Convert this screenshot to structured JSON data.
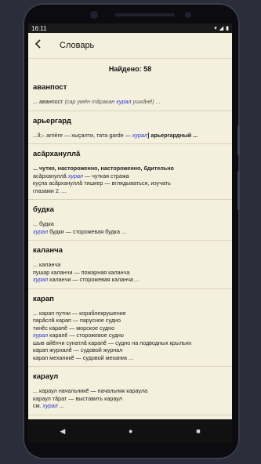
{
  "status": {
    "time": "16:11"
  },
  "appbar": {
    "title": "Словарь"
  },
  "found": "Найдено: 58",
  "entries": [
    {
      "head": "аванпост",
      "lines": [
        {
          "parts": [
            {
              "t": "... аванпост ",
              "c": ""
            },
            {
              "t": "(сар умĕн тăракан ",
              "c": "it"
            },
            {
              "t": "хурал",
              "c": "link"
            },
            {
              "t": " ушкăнĕ) ...",
              "c": "it"
            }
          ]
        }
      ]
    },
    {
      "head": "арьергард",
      "lines": [
        {
          "parts": [
            {
              "t": "...ll;– arrière — хыçалти, тата garde — ",
              "c": ""
            },
            {
              "t": "хурал",
              "c": "link"
            },
            {
              "t": "] арьергардный ...",
              "c": "b"
            }
          ]
        }
      ]
    },
    {
      "head": "асăрхануллă",
      "lines": [
        {
          "parts": [
            {
              "t": "... чутко, настороженно, настороженно, бдительно",
              "c": "b"
            }
          ]
        },
        {
          "parts": [
            {
              "t": "асăрхануллă ",
              "c": ""
            },
            {
              "t": "хурал",
              "c": "link"
            },
            {
              "t": " — чуткая стража",
              "c": ""
            }
          ]
        },
        {
          "parts": [
            {
              "t": "куçпа асăрхануллă тишкер — вглядываться, изучать",
              "c": ""
            }
          ]
        },
        {
          "parts": [
            {
              "t": "глазами 2. ...",
              "c": ""
            }
          ]
        }
      ]
    },
    {
      "head": "будка",
      "lines": [
        {
          "parts": [
            {
              "t": "... будка",
              "c": ""
            }
          ]
        },
        {
          "parts": [
            {
              "t": "хурал",
              "c": "link"
            },
            {
              "t": " будки — сторожевая будка ...",
              "c": ""
            }
          ]
        }
      ]
    },
    {
      "head": "каланча",
      "lines": [
        {
          "parts": [
            {
              "t": "... каланча",
              "c": ""
            }
          ]
        },
        {
          "parts": [
            {
              "t": "пушар каланчи — пожарная каланча",
              "c": ""
            }
          ]
        },
        {
          "parts": [
            {
              "t": "хурал",
              "c": "link"
            },
            {
              "t": " каланчи — сторожевая каланча ...",
              "c": ""
            }
          ]
        }
      ]
    },
    {
      "head": "карап",
      "lines": [
        {
          "parts": [
            {
              "t": "... карап путни — кораблекрушение",
              "c": ""
            }
          ]
        },
        {
          "parts": [
            {
              "t": "парăслă карап — парусное судно",
              "c": ""
            }
          ]
        },
        {
          "parts": [
            {
              "t": "тинĕс карапĕ — морское судно",
              "c": ""
            }
          ]
        },
        {
          "parts": [
            {
              "t": "хурал",
              "c": "link"
            },
            {
              "t": " карапĕ — сторожевое судно",
              "c": ""
            }
          ]
        },
        {
          "parts": [
            {
              "t": "шыв айĕнчи сунатлă карапĕ — судно на подводных крыльях",
              "c": ""
            }
          ]
        },
        {
          "parts": [
            {
              "t": "карап журналĕ — судовой журнал",
              "c": ""
            }
          ]
        },
        {
          "parts": [
            {
              "t": "карап механикĕ — судовой механик ...",
              "c": ""
            }
          ]
        }
      ]
    },
    {
      "head": "караул",
      "lines": [
        {
          "parts": [
            {
              "t": "... караул начальникĕ — начальник караула",
              "c": ""
            }
          ]
        },
        {
          "parts": [
            {
              "t": "караул тăрат — выставить караул",
              "c": ""
            }
          ]
        },
        {
          "parts": [
            {
              "t": "см. ",
              "c": ""
            },
            {
              "t": "хурал",
              "c": "link"
            },
            {
              "t": " ...",
              "c": ""
            }
          ]
        }
      ]
    }
  ]
}
